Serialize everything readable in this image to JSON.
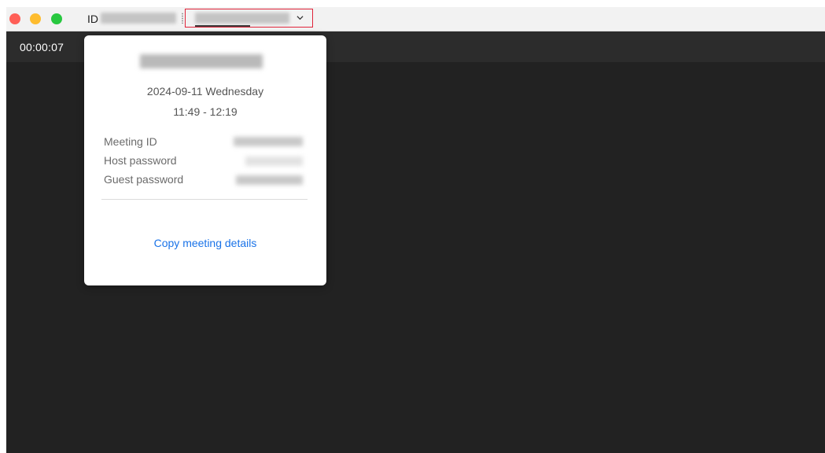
{
  "titlebar": {
    "id_label": "ID",
    "traffic_lights": {
      "close_color": "#ff5f57",
      "minimize_color": "#febc2e",
      "maximize_color": "#28c840"
    },
    "topic_selector_icon": "chevron-down-icon",
    "topic_selector_highlight_color": "#e0243a"
  },
  "meeting": {
    "elapsed_time": "00:00:07"
  },
  "details_popover": {
    "date": "2024-09-11 Wednesday",
    "time_range": "11:49 - 12:19",
    "fields": [
      {
        "label": "Meeting ID"
      },
      {
        "label": "Host password"
      },
      {
        "label": "Guest password"
      }
    ],
    "copy_label": "Copy meeting details",
    "link_color": "#1a73e8"
  }
}
